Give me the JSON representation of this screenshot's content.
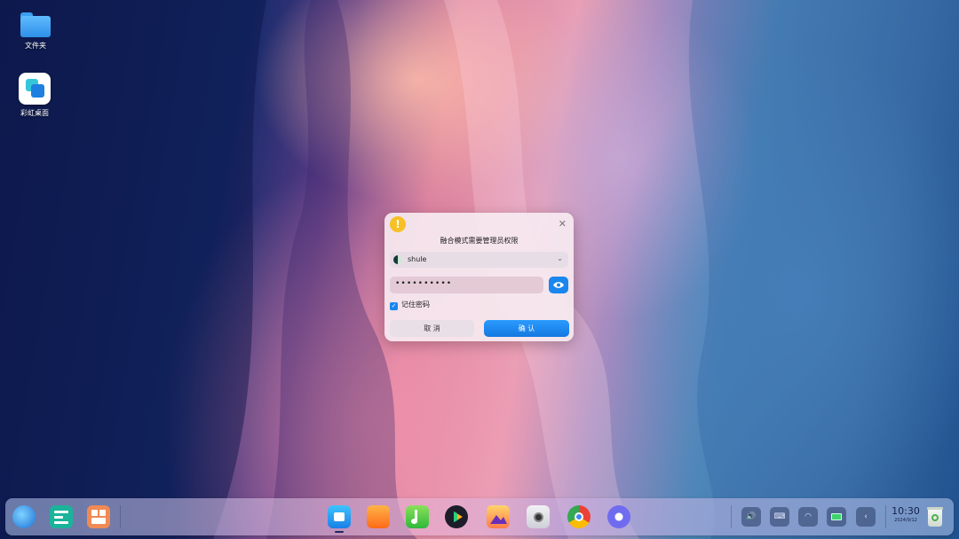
{
  "desktop": {
    "icons": [
      {
        "label": "文件夹",
        "icon": "folder-icon"
      },
      {
        "label": "彩虹桌面",
        "icon": "rainbow-desktop-app-icon"
      }
    ]
  },
  "dialog": {
    "title": "融合模式需要管理员权限",
    "user_name": "shule",
    "password_mask": "••••••••••",
    "remember_label": "记住密码",
    "remember_checked": true,
    "cancel_label": "取 消",
    "confirm_label": "确 认",
    "warn_glyph": "!",
    "close_glyph": "✕",
    "chevron_glyph": "⌄"
  },
  "dock": {
    "left_apps": [
      "launcher-icon",
      "multitasking-icon",
      "workspace-icon"
    ],
    "center_apps": [
      "file-manager-icon",
      "app-store-icon",
      "music-icon",
      "video-player-icon",
      "image-viewer-icon",
      "camera-icon",
      "chrome-icon",
      "settings-icon"
    ],
    "tray": [
      "volume-icon",
      "keyboard-icon",
      "wifi-icon",
      "battery-icon",
      "expand-tray-icon"
    ],
    "clock_time": "10:30",
    "clock_date": "2024/9/12"
  },
  "colors": {
    "accent": "#1a86ee",
    "warning": "#f6c026"
  }
}
